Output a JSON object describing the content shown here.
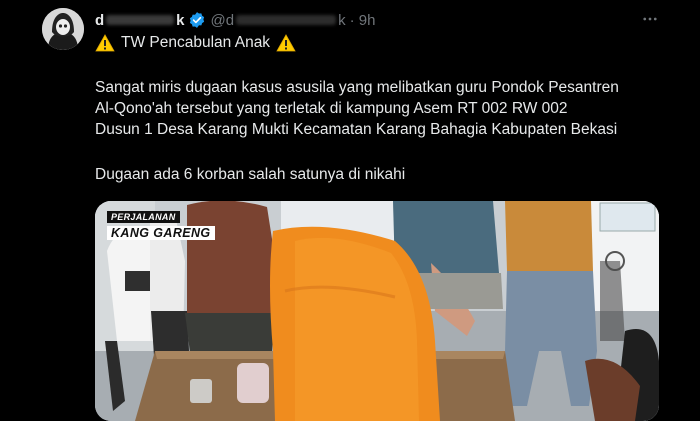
{
  "tweet": {
    "display_name_start": "d",
    "display_name_end": "k",
    "handle_start": "@d",
    "handle_end": "k",
    "time": "· 9h",
    "title": "TW Pencabulan Anak",
    "body_lines": [
      "Sangat miris dugaan kasus asusila yang melibatkan guru Pondok Pesantren",
      "Al-Qono'ah tersebut yang terletak di kampung Asem RT 002 RW 002",
      "Dusun 1 Desa Karang Mukti Kecamatan Karang Bahagia Kabupaten Bekasi"
    ],
    "body_line2": "Dugaan ada 6 korban salah satunya di nikahi"
  },
  "media": {
    "watermark_top": "PERJALANAN",
    "watermark_bottom": "KANG GARENG"
  },
  "icons": {
    "verified": "verified-badge-icon",
    "more": "more-options-icon",
    "warning": "warning-icon"
  },
  "colors": {
    "background": "#000000",
    "text": "#e7e9ea",
    "secondary": "#71767b",
    "verified": "#1d9bf0",
    "warning": "#ffcc00"
  }
}
